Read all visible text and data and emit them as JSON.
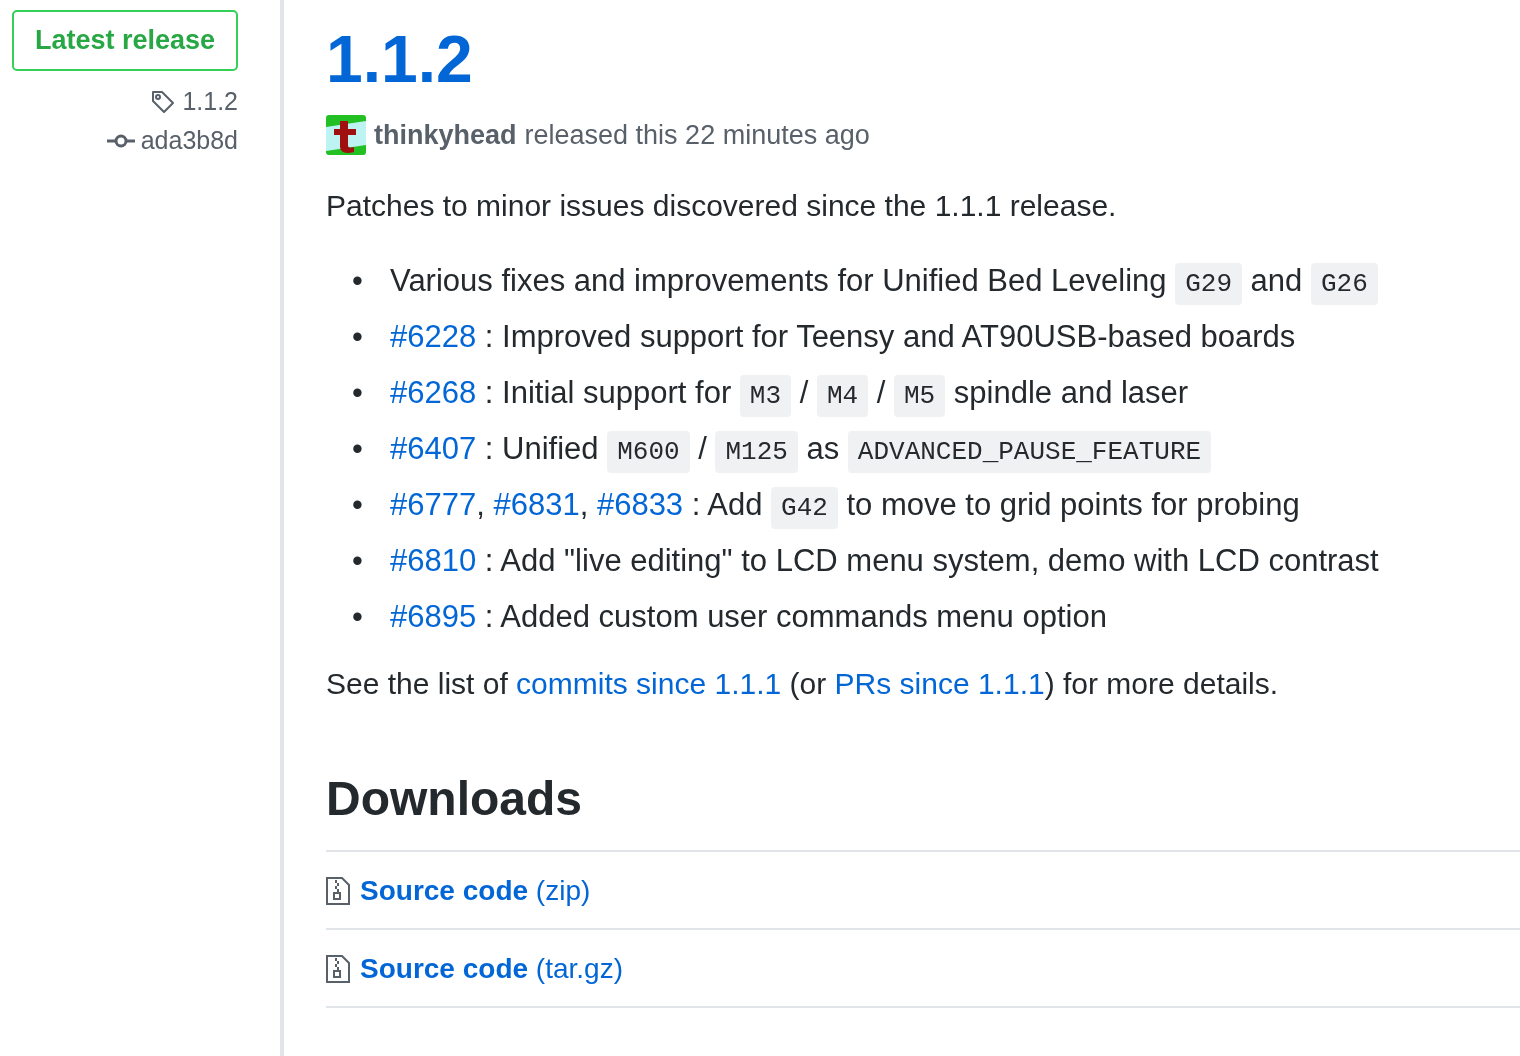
{
  "sidebar": {
    "badge": "Latest release",
    "tag": "1.1.2",
    "commit": "ada3b8d"
  },
  "release": {
    "title": "1.1.2",
    "author": "thinkyhead",
    "meta": "released this 22 minutes ago",
    "intro": "Patches to minor issues discovered since the 1.1.1 release.",
    "items": [
      {
        "bullet": "•",
        "segments": [
          {
            "kind": "text",
            "text": "Various fixes and improvements for Unified Bed Leveling "
          },
          {
            "kind": "code",
            "text": "G29"
          },
          {
            "kind": "text",
            "text": " and "
          },
          {
            "kind": "code",
            "text": "G26"
          }
        ]
      },
      {
        "bullet": "•",
        "segments": [
          {
            "kind": "link",
            "text": "#6228"
          },
          {
            "kind": "text",
            "text": " : Improved support for Teensy and AT90USB-based boards"
          }
        ]
      },
      {
        "bullet": "•",
        "segments": [
          {
            "kind": "link",
            "text": "#6268"
          },
          {
            "kind": "text",
            "text": " : Initial support for "
          },
          {
            "kind": "code",
            "text": "M3"
          },
          {
            "kind": "text",
            "text": " / "
          },
          {
            "kind": "code",
            "text": "M4"
          },
          {
            "kind": "text",
            "text": " / "
          },
          {
            "kind": "code",
            "text": "M5"
          },
          {
            "kind": "text",
            "text": " spindle and laser"
          }
        ]
      },
      {
        "bullet": "•",
        "segments": [
          {
            "kind": "link",
            "text": "#6407"
          },
          {
            "kind": "text",
            "text": " : Unified "
          },
          {
            "kind": "code",
            "text": "M600"
          },
          {
            "kind": "text",
            "text": " / "
          },
          {
            "kind": "code",
            "text": "M125"
          },
          {
            "kind": "text",
            "text": " as "
          },
          {
            "kind": "code",
            "text": "ADVANCED_PAUSE_FEATURE"
          }
        ]
      },
      {
        "bullet": "•",
        "segments": [
          {
            "kind": "link",
            "text": "#6777"
          },
          {
            "kind": "text",
            "text": ", "
          },
          {
            "kind": "link",
            "text": "#6831"
          },
          {
            "kind": "text",
            "text": ", "
          },
          {
            "kind": "link",
            "text": "#6833"
          },
          {
            "kind": "text",
            "text": " : Add "
          },
          {
            "kind": "code",
            "text": "G42"
          },
          {
            "kind": "text",
            "text": " to move to grid points for probing"
          }
        ]
      },
      {
        "bullet": "•",
        "segments": [
          {
            "kind": "link",
            "text": "#6810"
          },
          {
            "kind": "text",
            "text": " : Add \"live editing\" to LCD menu system, demo with LCD contrast"
          }
        ]
      },
      {
        "bullet": "•",
        "segments": [
          {
            "kind": "link",
            "text": "#6895"
          },
          {
            "kind": "text",
            "text": " : Added custom user commands menu option"
          }
        ]
      }
    ],
    "footer": [
      {
        "kind": "text",
        "text": "See the list of "
      },
      {
        "kind": "link",
        "text": "commits since 1.1.1"
      },
      {
        "kind": "text",
        "text": " (or "
      },
      {
        "kind": "link",
        "text": "PRs since 1.1.1"
      },
      {
        "kind": "text",
        "text": ") for more details."
      }
    ],
    "downloads_heading": "Downloads",
    "downloads": [
      "**Source code** (zip)",
      "**Source code** (tar.gz)"
    ]
  }
}
